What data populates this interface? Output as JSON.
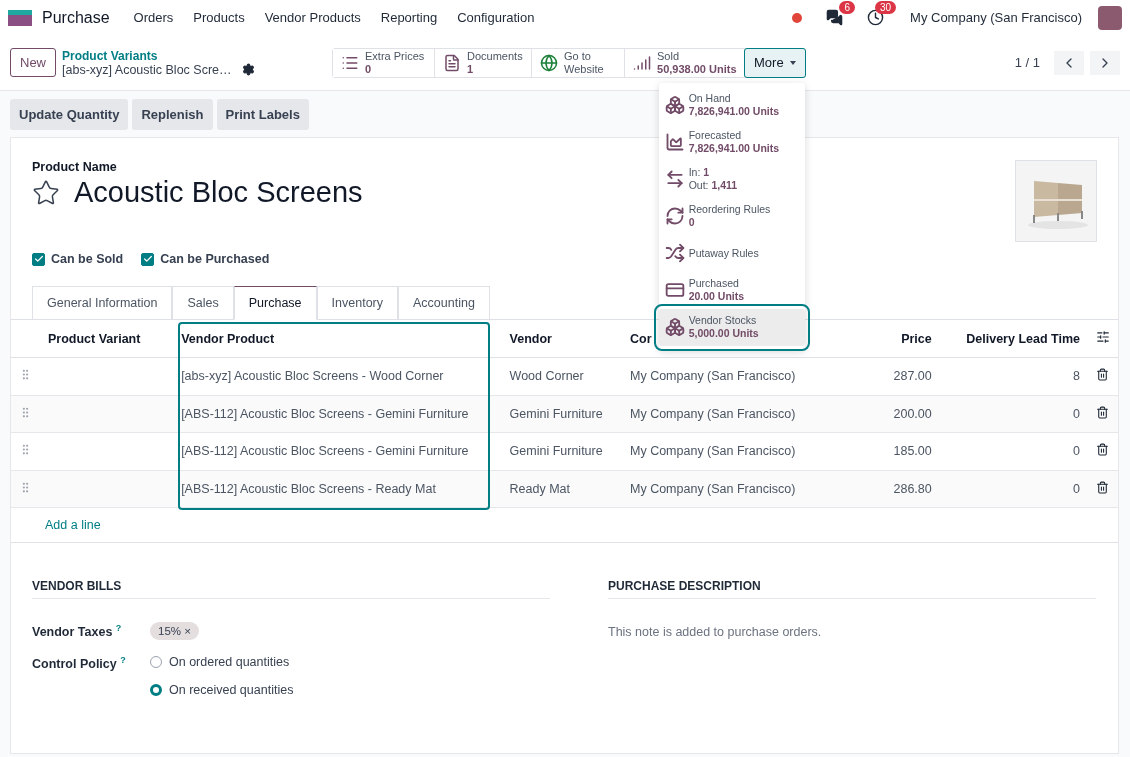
{
  "navbar": {
    "app": "Purchase",
    "menus": [
      "Orders",
      "Products",
      "Vendor Products",
      "Reporting",
      "Configuration"
    ],
    "messages_badge": "6",
    "activities_badge": "30",
    "company": "My Company (San Francisco)"
  },
  "control_panel": {
    "new_button": "New",
    "breadcrumb": "Product Variants",
    "record": "[abs-xyz] Acoustic Bloc Scre…",
    "pager": "1 / 1",
    "stat_buttons": [
      {
        "label": "Extra Prices",
        "value": "0"
      },
      {
        "label": "Documents",
        "value": "1"
      },
      {
        "label": "Go to Website"
      },
      {
        "label": "Sold",
        "value": "50,938.00 Units"
      }
    ],
    "more_button": "More",
    "more_menu": [
      {
        "lines": [
          {
            "label": "On Hand"
          },
          {
            "value": "7,826,941.00 Units"
          }
        ],
        "highlighted": false
      },
      {
        "lines": [
          {
            "label": "Forecasted"
          },
          {
            "value": "7,826,941.00 Units"
          }
        ],
        "highlighted": false
      },
      {
        "lines": [
          {
            "label": "In:",
            "value": "1"
          },
          {
            "label": "Out:",
            "value": "1,411"
          }
        ],
        "highlighted": false
      },
      {
        "lines": [
          {
            "label": "Reordering Rules"
          },
          {
            "value": "0"
          }
        ],
        "highlighted": false
      },
      {
        "lines": [
          {
            "label": "Putaway Rules"
          }
        ],
        "highlighted": false
      },
      {
        "lines": [
          {
            "label": "Purchased"
          },
          {
            "value": "20.00 Units"
          }
        ],
        "highlighted": false
      },
      {
        "lines": [
          {
            "label": "Vendor Stocks"
          },
          {
            "value": "5,000.00 Units"
          }
        ],
        "highlighted": true
      }
    ]
  },
  "action_buttons": [
    "Update Quantity",
    "Replenish",
    "Print Labels"
  ],
  "form": {
    "name_label": "Product Name",
    "name": "Acoustic Bloc Screens",
    "favorite": false,
    "checkboxes": [
      {
        "label": "Can be Sold",
        "checked": true
      },
      {
        "label": "Can be Purchased",
        "checked": true
      }
    ],
    "tabs": [
      {
        "label": "General Information",
        "selected": false
      },
      {
        "label": "Sales",
        "selected": false
      },
      {
        "label": "Purchase",
        "selected": true
      },
      {
        "label": "Inventory",
        "selected": false
      },
      {
        "label": "Accounting",
        "selected": false
      }
    ],
    "table": {
      "columns": [
        {
          "label": "Product Variant",
          "highlighted": false
        },
        {
          "label": "Vendor Product",
          "highlighted": true
        },
        {
          "label": "Vendor",
          "highlighted": false
        },
        {
          "label": "Cor",
          "highlighted": false
        },
        {
          "label": "Price",
          "highlighted": false
        },
        {
          "label": "Delivery Lead Time",
          "highlighted": false
        }
      ],
      "rows": [
        [
          "",
          "[abs-xyz] Acoustic Bloc Screens - Wood Corner",
          "Wood Corner",
          "My Company (San Francisco)",
          "287.00",
          "8"
        ],
        [
          "",
          "[ABS-112] Acoustic Bloc Screens - Gemini Furniture",
          "Gemini Furniture",
          "My Company (San Francisco)",
          "200.00",
          "0"
        ],
        [
          "",
          "[ABS-112] Acoustic Bloc Screens - Gemini Furniture",
          "Gemini Furniture",
          "My Company (San Francisco)",
          "185.00",
          "0"
        ],
        [
          "",
          "[ABS-112] Acoustic Bloc Screens - Ready Mat",
          "Ready Mat",
          "My Company (San Francisco)",
          "286.80",
          "0"
        ]
      ],
      "add_line": "Add a line"
    },
    "vendor_bills": {
      "title": "VENDOR BILLS",
      "taxes_label": "Vendor Taxes",
      "help_mark": "?",
      "tax_tags": [
        "15%"
      ],
      "tag_remove": "×",
      "policy_label": "Control Policy",
      "policy_options": [
        {
          "label": "On ordered quantities",
          "selected": false
        },
        {
          "label": "On received quantities",
          "selected": true
        }
      ]
    },
    "purchase_description": {
      "title": "PURCHASE DESCRIPTION",
      "placeholder": "This note is added to purchase orders."
    }
  }
}
